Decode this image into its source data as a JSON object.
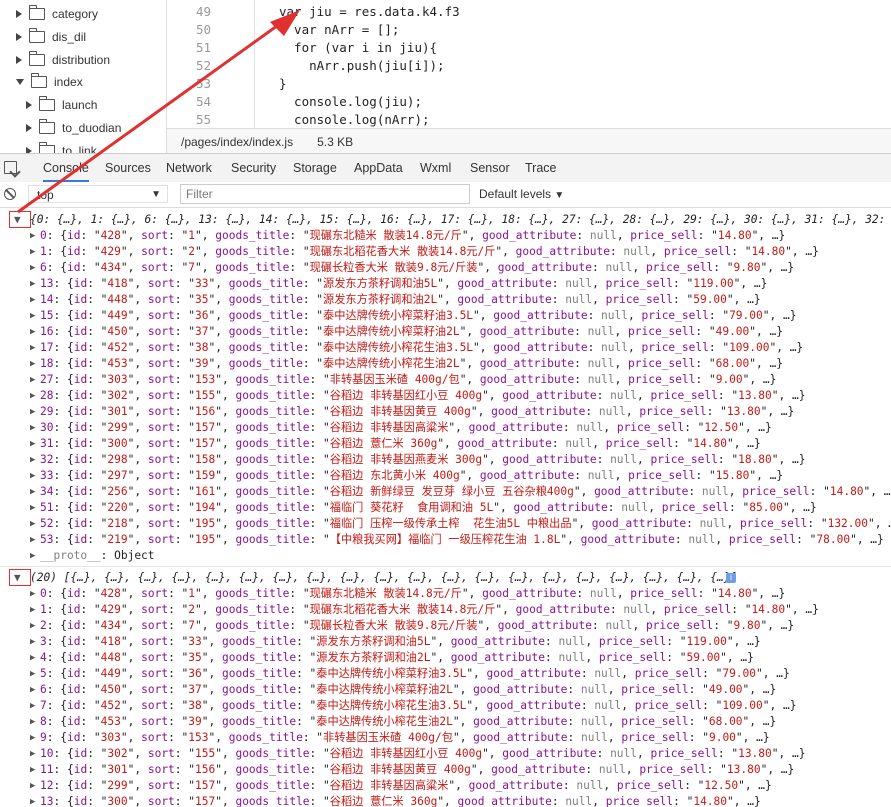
{
  "tree": {
    "items": [
      {
        "label": "category",
        "open": false
      },
      {
        "label": "dis_dil",
        "open": false
      },
      {
        "label": "distribution",
        "open": false
      },
      {
        "label": "index",
        "open": true
      },
      {
        "label": "launch",
        "open": false
      },
      {
        "label": "to_duodian",
        "open": false
      },
      {
        "label": "to_link",
        "open": false
      }
    ]
  },
  "editor": {
    "lines": [
      {
        "n": "49",
        "code": "var jiu = res.data.k4.f3"
      },
      {
        "n": "50",
        "code": "  var nArr = [];"
      },
      {
        "n": "51",
        "code": "  for (var i in jiu){"
      },
      {
        "n": "52",
        "code": "    nArr.push(jiu[i]);"
      },
      {
        "n": "53",
        "code": "}"
      },
      {
        "n": "54",
        "code": "  console.log(jiu);"
      },
      {
        "n": "55",
        "code": "  console.log(nArr);"
      }
    ],
    "file_path": "/pages/index/index.js",
    "file_size": "5.3 KB"
  },
  "tabs": [
    "Console",
    "Sources",
    "Network",
    "Security",
    "Storage",
    "AppData",
    "Wxml",
    "Sensor",
    "Trace"
  ],
  "active_tab": "Console",
  "filterbar": {
    "context": "top",
    "filter_placeholder": "Filter",
    "levels": "Default levels"
  },
  "console": {
    "log1_header": "{0: {…}, 1: {…}, 6: {…}, 13: {…}, 14: {…}, 15: {…}, 16: {…}, 17: {…}, 18: {…}, 27: {…}, 28: {…}, 29: {…}, 30: {…}, 31: {…}, 32: {",
    "log1_rows": [
      {
        "k": "0",
        "id": "428",
        "sort": "1",
        "title": "现碾东北糙米 散装14.8元/斤",
        "price": "14.80"
      },
      {
        "k": "1",
        "id": "429",
        "sort": "2",
        "title": "现碾东北稻花香大米 散装14.8元/斤",
        "price": "14.80"
      },
      {
        "k": "6",
        "id": "434",
        "sort": "7",
        "title": "现碾长粒香大米 散装9.8元/斤装",
        "price": "9.80"
      },
      {
        "k": "13",
        "id": "418",
        "sort": "33",
        "title": "源发东方茶籽调和油5L",
        "price": "119.00"
      },
      {
        "k": "14",
        "id": "448",
        "sort": "35",
        "title": "源发东方茶籽调和油2L",
        "price": "59.00"
      },
      {
        "k": "15",
        "id": "449",
        "sort": "36",
        "title": "泰中达牌传统小榨菜籽油3.5L",
        "price": "79.00"
      },
      {
        "k": "16",
        "id": "450",
        "sort": "37",
        "title": "泰中达牌传统小榨菜籽油2L",
        "price": "49.00"
      },
      {
        "k": "17",
        "id": "452",
        "sort": "38",
        "title": "泰中达牌传统小榨花生油3.5L",
        "price": "109.00"
      },
      {
        "k": "18",
        "id": "453",
        "sort": "39",
        "title": "泰中达牌传统小榨花生油2L",
        "price": "68.00"
      },
      {
        "k": "27",
        "id": "303",
        "sort": "153",
        "title": "非转基因玉米碴 400g/包",
        "price": "9.00"
      },
      {
        "k": "28",
        "id": "302",
        "sort": "155",
        "title": "谷稻边 非转基因红小豆 400g",
        "price": "13.80"
      },
      {
        "k": "29",
        "id": "301",
        "sort": "156",
        "title": "谷稻边 非转基因黄豆 400g",
        "price": "13.80"
      },
      {
        "k": "30",
        "id": "299",
        "sort": "157",
        "title": "谷稻边 非转基因高粱米",
        "price": "12.50"
      },
      {
        "k": "31",
        "id": "300",
        "sort": "157",
        "title": "谷稻边 薏仁米 360g",
        "price": "14.80"
      },
      {
        "k": "32",
        "id": "298",
        "sort": "158",
        "title": "谷稻边 非转基因燕麦米 300g",
        "price": "18.80"
      },
      {
        "k": "33",
        "id": "297",
        "sort": "159",
        "title": "谷稻边 东北黄小米 400g",
        "price": "15.80"
      },
      {
        "k": "34",
        "id": "256",
        "sort": "161",
        "title": "谷稻边 新鲜绿豆 发豆芽 绿小豆 五谷杂粮400g",
        "price": "14.80"
      },
      {
        "k": "51",
        "id": "220",
        "sort": "194",
        "title": "福临门 葵花籽  食用调和油 5L",
        "price": "85.00"
      },
      {
        "k": "52",
        "id": "218",
        "sort": "195",
        "title": "福临门 压榨一级传承土榨  花生油5L 中粮出品",
        "price": "132.00"
      },
      {
        "k": "53",
        "id": "219",
        "sort": "195",
        "title": "【中粮我买网】福临门 一级压榨花生油 1.8L",
        "price": "78.00"
      }
    ],
    "proto_label": "__proto__",
    "proto_value": "Object",
    "log2_header": "(20) [{…}, {…}, {…}, {…}, {…}, {…}, {…}, {…}, {…}, {…}, {…}, {…}, {…}, {…}, {…}, {…}, {…}, {…}, {…}, {…}]",
    "info_icon": "i",
    "log2_rows": [
      {
        "k": "0",
        "id": "428",
        "sort": "1",
        "title": "现碾东北糙米 散装14.8元/斤",
        "price": "14.80"
      },
      {
        "k": "1",
        "id": "429",
        "sort": "2",
        "title": "现碾东北稻花香大米 散装14.8元/斤",
        "price": "14.80"
      },
      {
        "k": "2",
        "id": "434",
        "sort": "7",
        "title": "现碾长粒香大米 散装9.8元/斤装",
        "price": "9.80"
      },
      {
        "k": "3",
        "id": "418",
        "sort": "33",
        "title": "源发东方茶籽调和油5L",
        "price": "119.00"
      },
      {
        "k": "4",
        "id": "448",
        "sort": "35",
        "title": "源发东方茶籽调和油2L",
        "price": "59.00"
      },
      {
        "k": "5",
        "id": "449",
        "sort": "36",
        "title": "泰中达牌传统小榨菜籽油3.5L",
        "price": "79.00"
      },
      {
        "k": "6",
        "id": "450",
        "sort": "37",
        "title": "泰中达牌传统小榨菜籽油2L",
        "price": "49.00"
      },
      {
        "k": "7",
        "id": "452",
        "sort": "38",
        "title": "泰中达牌传统小榨花生油3.5L",
        "price": "109.00"
      },
      {
        "k": "8",
        "id": "453",
        "sort": "39",
        "title": "泰中达牌传统小榨花生油2L",
        "price": "68.00"
      },
      {
        "k": "9",
        "id": "303",
        "sort": "153",
        "title": "非转基因玉米碴 400g/包",
        "price": "9.00"
      },
      {
        "k": "10",
        "id": "302",
        "sort": "155",
        "title": "谷稻边 非转基因红小豆 400g",
        "price": "13.80"
      },
      {
        "k": "11",
        "id": "301",
        "sort": "156",
        "title": "谷稻边 非转基因黄豆 400g",
        "price": "13.80"
      },
      {
        "k": "12",
        "id": "299",
        "sort": "157",
        "title": "谷稻边 非转基因高粱米",
        "price": "12.50"
      },
      {
        "k": "13",
        "id": "300",
        "sort": "157",
        "title": "谷稻边 薏仁米 360g",
        "price": "14.80"
      }
    ],
    "field_labels": {
      "id": "id",
      "sort": "sort",
      "title": "goods_title",
      "attr": "good_attribute",
      "attr_val": "null",
      "price": "price_sell"
    }
  },
  "colors": {
    "annotation_red": "#e03030",
    "active_tab": "#3879d9"
  }
}
